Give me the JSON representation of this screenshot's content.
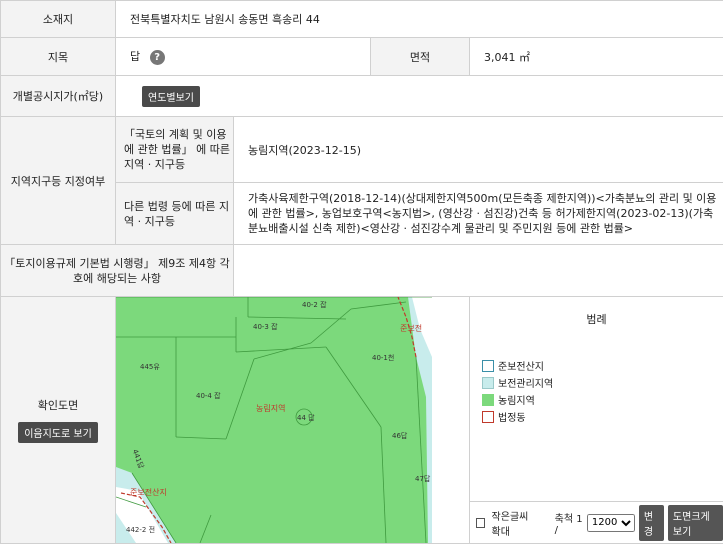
{
  "location": {
    "label": "소재지",
    "value": "전북특별자치도 남원시 송동면 흑송리 44"
  },
  "jimok": {
    "label": "지목",
    "value": "답",
    "help_icon": "?"
  },
  "area": {
    "label": "면적",
    "value": "3,041 ㎡"
  },
  "official_price": {
    "label": "개별공시지가(㎡당)",
    "button": "연도별보기"
  },
  "zoning": {
    "label": "지역지구등 지정여부",
    "row1_label": "「국토의 계획 및 이용에 관한 법률」 에 따른 지역 · 지구등",
    "row1_value": "농림지역(2023-12-15)",
    "row2_label": "다른 법령 등에 따른 지역 · 지구등",
    "row2_value": "가축사육제한구역(2018-12-14)(상대제한지역500m(모든축종 제한지역))<가축분뇨의 관리 및 이용에 관한 법률>, 농업보호구역<농지법>, (영산강 · 섬진강)건축 등 허가제한지역(2023-02-13)(가축분뇨배출시설 신축 제한)<영산강 · 섬진강수계 물관리 및 주민지원 등에 관한 법률>"
  },
  "decree": {
    "label": "「토지이용규제 기본법 시행령」 제9조 제4항 각 호에 해당되는 사항",
    "value": ""
  },
  "map_section": {
    "label": "확인도면",
    "button": "이음지도로 보기",
    "map_labels": {
      "p40_2": "40-2 잡",
      "p40_3": "40-3 잡",
      "p40_1": "40-1천",
      "p445": "445유",
      "p40_4": "40-4 잡",
      "zone_center": "농림지역",
      "p44": "44 답",
      "p46": "46답",
      "p47": "47답",
      "p441": "441답",
      "p442": "442-2 전",
      "top_right": "준보전",
      "bottom_left": "준보전산지"
    }
  },
  "legend": {
    "title": "범례",
    "items": [
      {
        "label": "준보전산지",
        "color": "#ffffff",
        "border": "#3a8fa8"
      },
      {
        "label": "보전관리지역",
        "color": "#c8ecec",
        "border": "#9ac9c9"
      },
      {
        "label": "농림지역",
        "color": "#7cd97c",
        "border": "#7cd97c"
      },
      {
        "label": "법정동",
        "color": "#ffffff",
        "border": "#c0392b"
      }
    ]
  },
  "controls": {
    "small_font": "작은글씨확대",
    "scale_label": "축척 1 /",
    "scale_value": "1200",
    "change_button": "변경",
    "enlarge_button": "도면크게보기"
  }
}
